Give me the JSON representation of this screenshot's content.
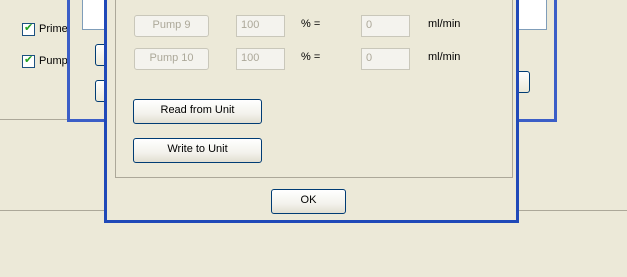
{
  "back_window": {
    "checkboxes": [
      {
        "label": "Prime",
        "checked": true
      },
      {
        "label": "Pump",
        "checked": true
      }
    ]
  },
  "dialog": {
    "rows": [
      {
        "pump_label": "Pump 9",
        "percent": "100",
        "percent_sign": "% =",
        "flow": "0",
        "unit": "ml/min"
      },
      {
        "pump_label": "Pump 10",
        "percent": "100",
        "percent_sign": "% =",
        "flow": "0",
        "unit": "ml/min"
      }
    ],
    "read_button": "Read from Unit",
    "write_button": "Write to Unit",
    "ok_button": "OK"
  },
  "colors": {
    "window_bg": "#ece9d8",
    "frame_blue": "#2049b8",
    "button_border": "#003c74",
    "disabled_text": "#aca899",
    "checkmark": "#21a121"
  }
}
